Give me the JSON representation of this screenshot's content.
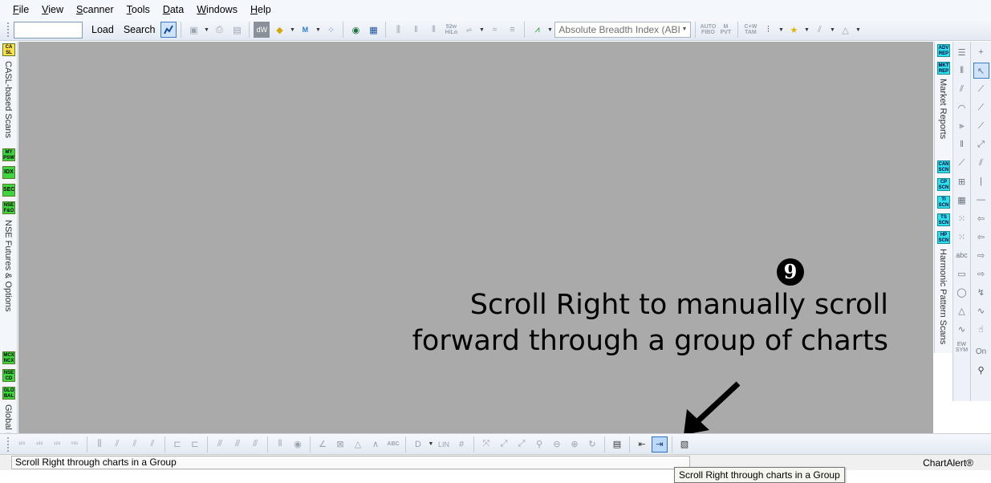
{
  "menu": {
    "items": [
      {
        "accel": "F",
        "rest": "ile"
      },
      {
        "accel": "V",
        "rest": "iew"
      },
      {
        "accel": "S",
        "rest": "canner"
      },
      {
        "accel": "T",
        "rest": "ools"
      },
      {
        "accel": "D",
        "rest": "ata"
      },
      {
        "accel": "W",
        "rest": "indows"
      },
      {
        "accel": "H",
        "rest": "elp"
      }
    ]
  },
  "toolbar": {
    "symbol_value": "",
    "load_label": "Load",
    "search_label": "Search",
    "indicator_value": "Absolute Breadth Index (ABI",
    "tiny": {
      "hilo": "52w HiLo",
      "fibo": "AUTO FIBO",
      "pvt": "M PVT",
      "tam": "C+W TAM"
    }
  },
  "left_dock": {
    "badges": {
      "casl": "CA SL",
      "mypsw": "MY PSW",
      "idx": "IDX",
      "sec": "SEC",
      "nsefo": "NSE F&O",
      "mcx": "MCX NCX",
      "nsecd": "NSE CD",
      "global": "GLO BAL"
    },
    "labels": {
      "casl": "CASL-based Scans",
      "nse": "NSE Futures & Options",
      "global": "Global I"
    }
  },
  "right_dock": {
    "badges": {
      "adv": "ADV REP",
      "mkt": "MKT REP",
      "can": "CAN SCN",
      "cp": "CP SCN",
      "ti": "TI SCN",
      "ts": "TS SCN",
      "hp": "HP SCN"
    },
    "labels": {
      "market": "Market Reports",
      "harmonic": "Harmonic Pattern Scans"
    },
    "tools": {
      "abc": "abc",
      "ew": "EW SYM",
      "on": "On"
    }
  },
  "annotation": {
    "number": "9",
    "line1": "Scroll Right to manually scroll",
    "line2": "forward through a group of charts"
  },
  "bottom_toolbar": {
    "lin": "LIN",
    "abc": "ABC"
  },
  "status": {
    "message": "Scroll Right through charts in a Group",
    "brand": "ChartAlert®",
    "tooltip": "Scroll Right through charts in a Group"
  }
}
